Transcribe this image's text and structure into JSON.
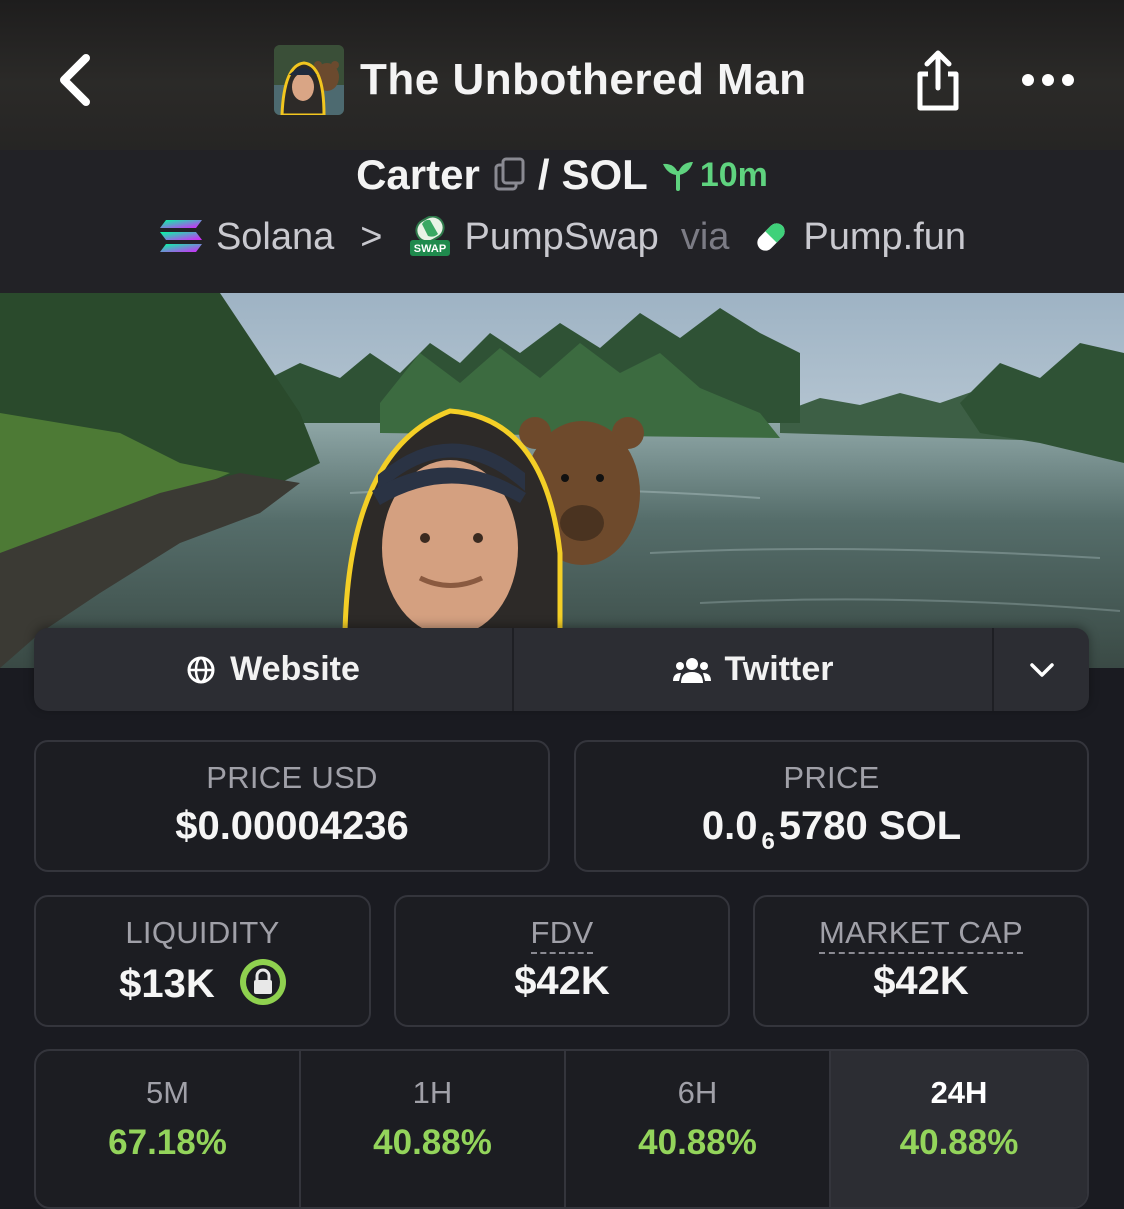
{
  "header": {
    "title": "The Unbothered Man",
    "back_icon": "chevron-left-icon",
    "share_icon": "share-icon",
    "more_icon": "more-horizontal-icon"
  },
  "pair": {
    "base": "Carter",
    "slash": "/",
    "quote": "SOL",
    "age": "10m",
    "age_color": "#5fd37f"
  },
  "route": {
    "chain": "Solana",
    "separator": ">",
    "dex": "PumpSwap",
    "dex_badge": "SWAP",
    "via": "via",
    "launchpad": "Pump.fun"
  },
  "links": {
    "website": "Website",
    "twitter": "Twitter"
  },
  "stats": {
    "price_usd_label": "PRICE USD",
    "price_usd_value": "$0.00004236",
    "price_label": "PRICE",
    "price_prefix": "0.0",
    "price_zeros": "6",
    "price_suffix": "5780 SOL",
    "liquidity_label": "LIQUIDITY",
    "liquidity_value": "$13K",
    "fdv_label": "FDV",
    "fdv_value": "$42K",
    "mcap_label": "MARKET CAP",
    "mcap_value": "$42K"
  },
  "changes": [
    {
      "label": "5M",
      "value": "67.18%"
    },
    {
      "label": "1H",
      "value": "40.88%"
    },
    {
      "label": "6H",
      "value": "40.88%"
    },
    {
      "label": "24H",
      "value": "40.88%"
    }
  ],
  "colors": {
    "positive": "#93d45b",
    "background": "#1a1b21",
    "card_border": "#34353c"
  }
}
